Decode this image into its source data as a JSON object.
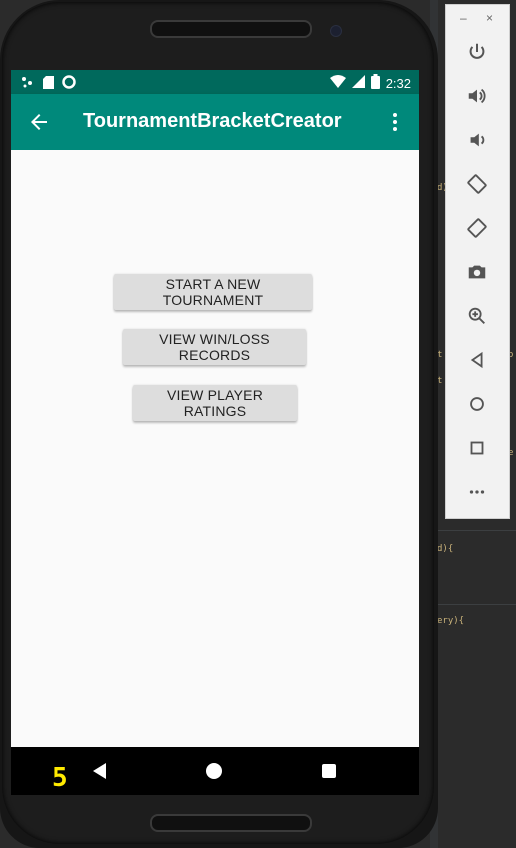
{
  "status_bar": {
    "time": "2:32",
    "icons": [
      "notification-dots-icon",
      "sd-card-icon",
      "sync-icon",
      "wifi-icon",
      "signal-icon",
      "battery-icon"
    ]
  },
  "app_bar": {
    "title": "TournamentBracketCreator",
    "back_icon": "arrow-back-icon",
    "menu_icon": "more-vert-icon"
  },
  "main": {
    "buttons": [
      {
        "label": "START A NEW TOURNAMENT"
      },
      {
        "label": "VIEW WIN/LOSS RECORDS"
      },
      {
        "label": "VIEW PLAYER RATINGS"
      }
    ]
  },
  "nav_bar": {
    "icons": [
      "back-triangle-icon",
      "home-circle-icon",
      "recents-square-icon"
    ]
  },
  "overlay": {
    "fps": "5"
  },
  "emulator_toolbar": {
    "minimize": "–",
    "close": "×",
    "items": [
      "power-icon",
      "volume-up-icon",
      "volume-down-icon",
      "rotate-left-icon",
      "rotate-right-icon",
      "camera-icon",
      "zoom-icon",
      "back-icon",
      "home-icon",
      "overview-icon",
      "more-icon"
    ]
  },
  "ide_snippets": {
    "line1": "d)",
    "line2": "t",
    "line3": "t",
    "line4": "d){",
    "line5": "ery){",
    "line6": "e",
    "line7": "o"
  },
  "colors": {
    "primary": "#00897b",
    "primary_dark": "#00695c",
    "button_bg": "#dddddd",
    "screen_bg": "#fafafa"
  }
}
